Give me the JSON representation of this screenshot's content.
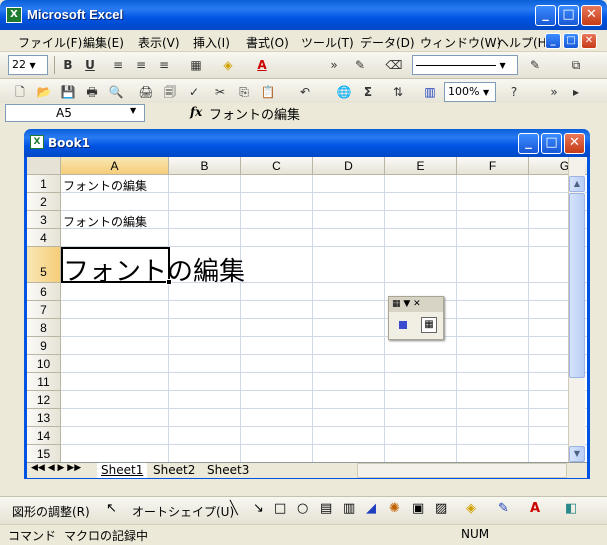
{
  "app": {
    "title": "Microsoft Excel"
  },
  "menu": [
    "ファイル(F)",
    "編集(E)",
    "表示(V)",
    "挿入(I)",
    "書式(O)",
    "ツール(T)",
    "データ(D)",
    "ウィンドウ(W)",
    "ヘルプ(H)"
  ],
  "format_toolbar": {
    "font_size": "22",
    "bold": "B",
    "underline": "U",
    "font_color_icon": "A"
  },
  "standard_toolbar": {
    "zoom": "100%",
    "sum": "Σ"
  },
  "formula_bar": {
    "name_box": "A5",
    "fx": "fx",
    "content": "フォントの編集"
  },
  "workbook": {
    "title": "Book1",
    "columns": [
      "A",
      "B",
      "C",
      "D",
      "E",
      "F",
      "G"
    ],
    "rows": [
      "1",
      "2",
      "3",
      "4",
      "5",
      "6",
      "7",
      "8",
      "9",
      "10",
      "11",
      "12",
      "13",
      "14",
      "15"
    ],
    "cells": {
      "a1": "フォントの編集",
      "a3": "フォントの編集",
      "a5": "フォントの編集"
    },
    "selected_cell": "A5",
    "sheets": [
      "Sheet1",
      "Sheet2",
      "Sheet3"
    ],
    "active_sheet": "Sheet1"
  },
  "drawing_toolbar": {
    "draw_menu": "図形の調整(R)",
    "autoshapes": "オートシェイプ(U)"
  },
  "status": {
    "mode": "コマンド",
    "macro": "マクロの記録中",
    "num": "NUM"
  },
  "colors": {
    "xp_blue": "#0054e3",
    "selection_header": "#f6cd78"
  }
}
